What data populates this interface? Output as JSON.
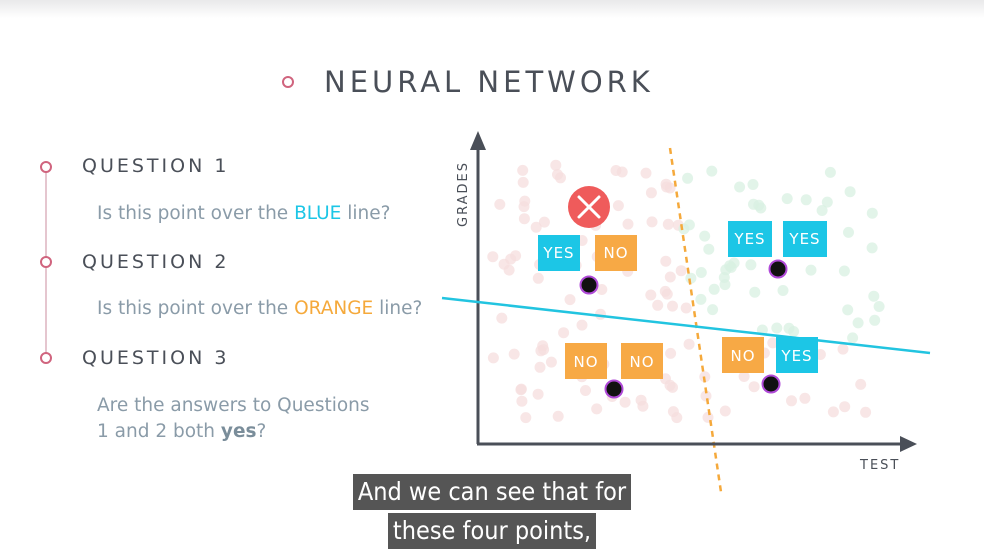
{
  "title": "NEURAL NETWORK",
  "questions": [
    {
      "heading": "QUESTION 1",
      "text_before": "Is this point over the ",
      "highlight": "BLUE",
      "text_after": " line?"
    },
    {
      "heading": "QUESTION 2",
      "text_before": "Is this point over the ",
      "highlight": "ORANGE",
      "text_after": " line?"
    },
    {
      "heading": "QUESTION 3",
      "line1": "Are the answers to Questions",
      "line2_before": "1 and 2 both ",
      "line2_bold": "yes",
      "line2_after": "?"
    }
  ],
  "axes": {
    "x_label": "TEST",
    "y_label": "GRADES"
  },
  "answer_groups": [
    {
      "left": "YES",
      "right": "NO"
    },
    {
      "left": "YES",
      "right": "YES"
    },
    {
      "left": "NO",
      "right": "NO"
    },
    {
      "left": "NO",
      "right": "YES"
    }
  ],
  "caption": {
    "line1": "And we can see that for",
    "line2": "these four points,"
  },
  "colors": {
    "blue_line": "#22c4e0",
    "orange_line": "#f5a93b",
    "yes_box": "#1cc6e6",
    "no_box": "#f7a945",
    "x_mark": "#ef5b5b",
    "accent_dot": "#d0647e"
  }
}
